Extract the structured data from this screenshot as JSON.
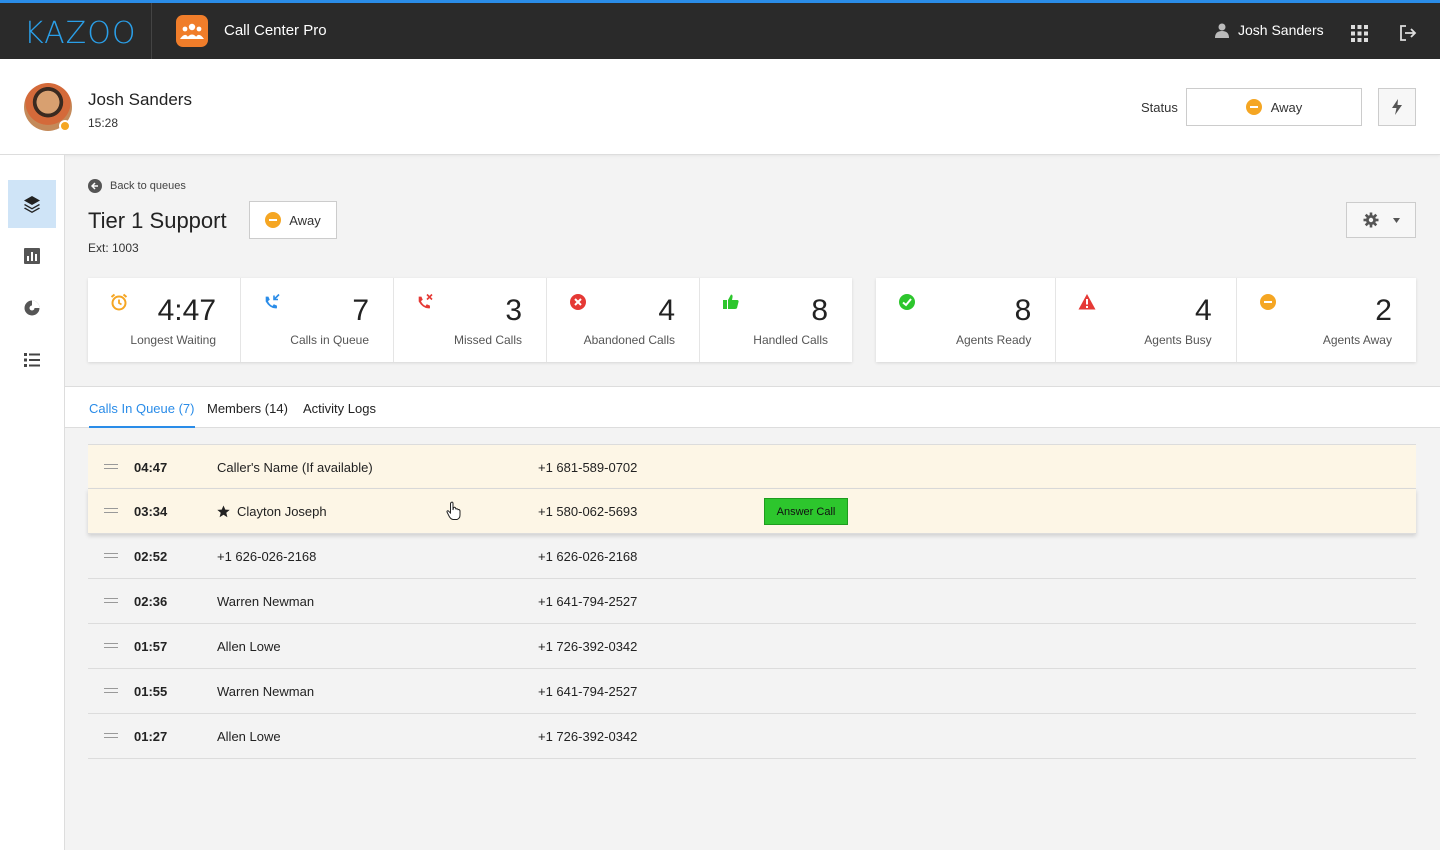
{
  "topbar": {
    "logo": "KAZOO",
    "app_title": "Call Center Pro",
    "user_name": "Josh Sanders",
    "icons": {
      "app": "users-group-icon",
      "user": "user-icon",
      "apps": "apps-grid-icon",
      "logout": "logout-icon"
    },
    "accent": "#2a8ce8",
    "app_color": "#f07d2a"
  },
  "header": {
    "user_name": "Josh Sanders",
    "time": "15:28",
    "status_label": "Status",
    "status_value": "Away",
    "status_color": "#f5a623"
  },
  "sidebar": {
    "items": [
      {
        "icon": "layers-icon",
        "active": true
      },
      {
        "icon": "bar-chart-icon",
        "active": false
      },
      {
        "icon": "pie-chart-icon",
        "active": false
      },
      {
        "icon": "checklist-icon",
        "active": false
      }
    ]
  },
  "queue": {
    "back_label": "Back to queues",
    "title": "Tier 1 Support",
    "ext": "Ext: 1003",
    "status": "Away"
  },
  "stats_queue": [
    {
      "icon": "alarm-clock-icon",
      "value": "4:47",
      "label": "Longest Waiting",
      "color": "#f5a623"
    },
    {
      "icon": "incoming-call-icon",
      "value": "7",
      "label": "Calls in Queue",
      "color": "#2a8ce8"
    },
    {
      "icon": "missed-call-icon",
      "value": "3",
      "label": "Missed Calls",
      "color": "#e53935"
    },
    {
      "icon": "x-circle-icon",
      "value": "4",
      "label": "Abandoned Calls",
      "color": "#e53935"
    },
    {
      "icon": "thumbs-up-icon",
      "value": "8",
      "label": "Handled Calls",
      "color": "#2dc62d"
    }
  ],
  "stats_agents": [
    {
      "icon": "check-circle-icon",
      "value": "8",
      "label": "Agents Ready",
      "color": "#2dc62d"
    },
    {
      "icon": "warning-icon",
      "value": "4",
      "label": "Agents Busy",
      "color": "#e53935"
    },
    {
      "icon": "minus-circle-icon",
      "value": "2",
      "label": "Agents Away",
      "color": "#f5a623"
    }
  ],
  "tabs": [
    {
      "label": "Calls In Queue (7)",
      "active": true
    },
    {
      "label": "Members (14)",
      "active": false
    },
    {
      "label": "Activity Logs",
      "active": false
    }
  ],
  "calls": [
    {
      "time": "04:47",
      "name": "Caller's Name (If available)",
      "number": "+1 681-589-0702",
      "starred": false
    },
    {
      "time": "03:34",
      "name": "Clayton Joseph",
      "number": "+1 580-062-5693",
      "starred": true,
      "answer_label": "Answer Call"
    },
    {
      "time": "02:52",
      "name": "+1 626-026-2168",
      "number": "+1 626-026-2168",
      "starred": false
    },
    {
      "time": "02:36",
      "name": "Warren Newman",
      "number": "+1 641-794-2527",
      "starred": false
    },
    {
      "time": "01:57",
      "name": "Allen Lowe",
      "number": "+1 726-392-0342",
      "starred": false
    },
    {
      "time": "01:55",
      "name": "Warren Newman",
      "number": "+1 641-794-2527",
      "starred": false
    },
    {
      "time": "01:27",
      "name": "Allen Lowe",
      "number": "+1 726-392-0342",
      "starred": false
    }
  ]
}
